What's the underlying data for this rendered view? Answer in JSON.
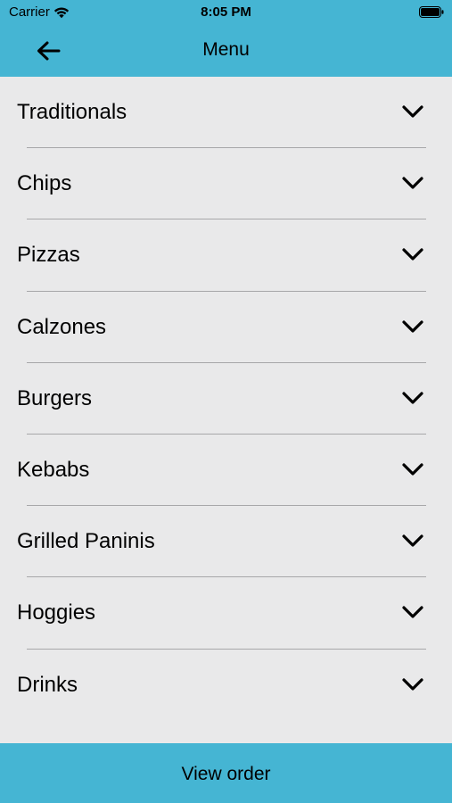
{
  "status_bar": {
    "carrier": "Carrier",
    "time": "8:05 PM",
    "wifi_icon": "wifi-icon",
    "battery_icon": "battery-icon"
  },
  "nav": {
    "title": "Menu",
    "back_icon": "arrow-left-icon"
  },
  "menu": {
    "items": [
      {
        "label": "Traditionals"
      },
      {
        "label": "Chips"
      },
      {
        "label": "Pizzas"
      },
      {
        "label": "Calzones"
      },
      {
        "label": "Burgers"
      },
      {
        "label": "Kebabs"
      },
      {
        "label": "Grilled Paninis"
      },
      {
        "label": "Hoggies"
      },
      {
        "label": "Drinks"
      }
    ],
    "expand_icon": "chevron-down-icon"
  },
  "footer": {
    "button_label": "View order"
  },
  "colors": {
    "accent": "#45b5d3",
    "background": "#e9e9ea",
    "divider": "#a7a7a9"
  }
}
